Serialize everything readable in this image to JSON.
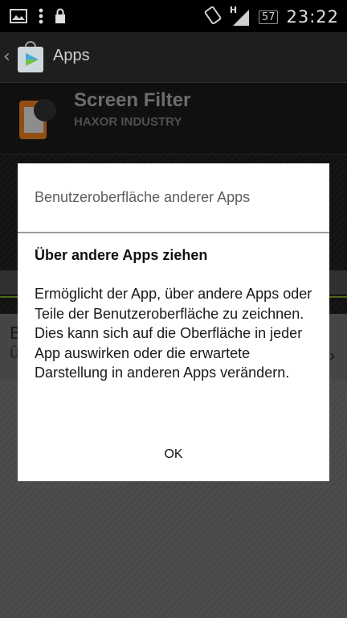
{
  "status_bar": {
    "time": "23:22",
    "battery": "57",
    "network_label": "H",
    "icons": [
      "image-icon",
      "more-icon",
      "lock-icon",
      "rotate-icon",
      "signal-icon",
      "battery-icon"
    ]
  },
  "action_bar": {
    "title": "Apps",
    "back_icon": "chevron-left-icon",
    "logo_icon": "play-store-icon"
  },
  "app_header": {
    "name": "Screen Filter",
    "developer": "HAXOR INDUSTRY"
  },
  "background_list": {
    "row_title": "B",
    "row_subtitle": "Ü",
    "chevron": "›"
  },
  "dialog": {
    "title": "Benutzeroberfläche anderer Apps",
    "subtitle": "Über andere Apps ziehen",
    "body": "Ermöglicht der App, über andere Apps oder Teile der Benutzeroberfläche zu zeichnen. Dies kann sich auf die Oberfläche in jeder App auswirken oder die erwartete Darstellung in anderen Apps verändern.",
    "ok_label": "OK"
  },
  "colors": {
    "accent_green": "#7aa32b",
    "dialog_bg": "#ffffff",
    "app_icon_orange": "#e07a1e"
  }
}
